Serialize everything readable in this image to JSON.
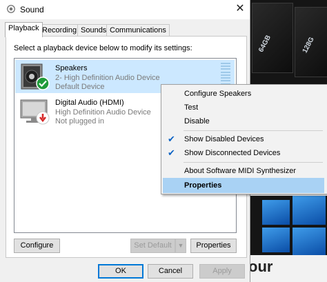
{
  "window": {
    "title": "Sound",
    "close_glyph": "✕"
  },
  "tabs": [
    {
      "label": "Playback",
      "active": true
    },
    {
      "label": "Recording",
      "active": false
    },
    {
      "label": "Sounds",
      "active": false
    },
    {
      "label": "Communications",
      "active": false
    }
  ],
  "instruction": "Select a playback device below to modify its settings:",
  "devices": [
    {
      "name": "Speakers",
      "line2": "2- High Definition Audio Device",
      "line3": "Default Device",
      "selected": true,
      "icon": "speaker-icon",
      "status_icon": "default-check-icon"
    },
    {
      "name": "Digital Audio (HDMI)",
      "line2": "High Definition Audio Device",
      "line3": "Not plugged in",
      "selected": false,
      "icon": "monitor-icon",
      "status_icon": "unplugged-arrow-icon"
    }
  ],
  "buttons": {
    "configure": "Configure",
    "set_default": "Set Default",
    "properties": "Properties",
    "ok": "OK",
    "cancel": "Cancel",
    "apply": "Apply"
  },
  "context_menu": {
    "items": [
      {
        "label": "Configure Speakers",
        "checked": false,
        "highlighted": false
      },
      {
        "label": "Test",
        "checked": false,
        "highlighted": false
      },
      {
        "label": "Disable",
        "checked": false,
        "highlighted": false
      },
      {
        "label": "Show Disabled Devices",
        "checked": true,
        "highlighted": false
      },
      {
        "label": "Show Disconnected Devices",
        "checked": true,
        "highlighted": false
      },
      {
        "label": "About Software MIDI Synthesizer",
        "checked": false,
        "highlighted": false
      },
      {
        "label": "Properties",
        "checked": false,
        "highlighted": true
      }
    ]
  },
  "background": {
    "sd_card_texts": [
      "64GB",
      "128G"
    ],
    "partial_text": "our"
  },
  "colors": {
    "selection": "#cce8ff",
    "menu_highlight": "#a9d2f4",
    "check_blue": "#0b62c4",
    "default_badge": "#1f9b3a",
    "unplugged_badge": "#d62828"
  }
}
